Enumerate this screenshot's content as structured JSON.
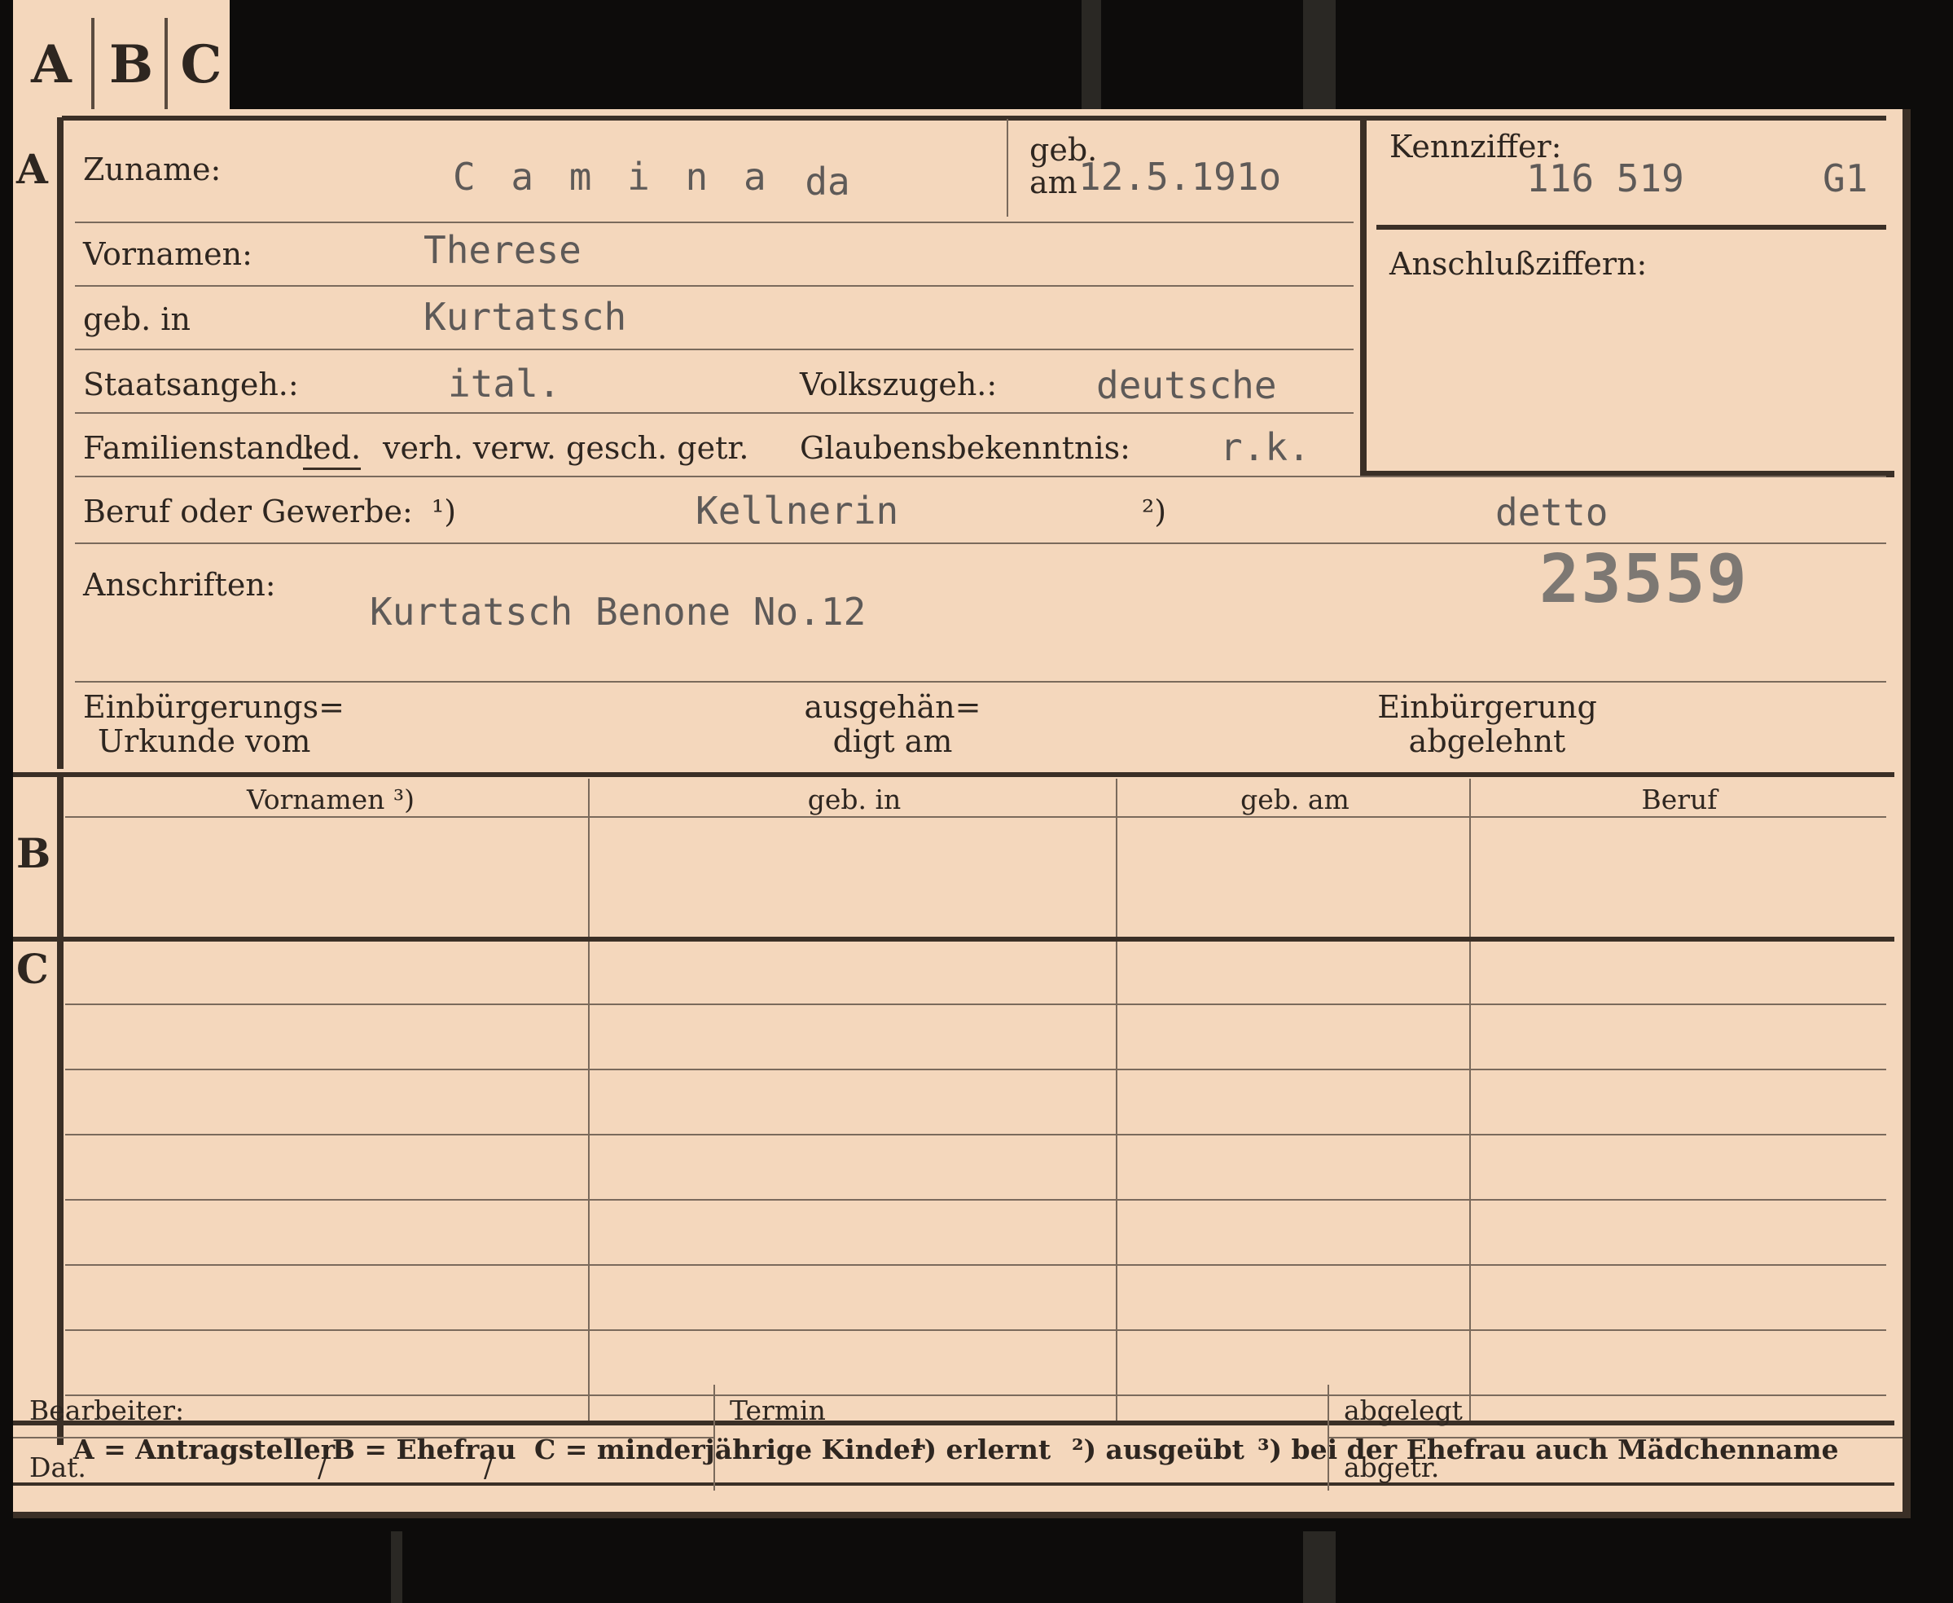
{
  "tab_letters": [
    "A",
    "B",
    "C"
  ],
  "section_letters": {
    "a": "A",
    "b": "B",
    "c": "C"
  },
  "labels": {
    "zuname": "Zuname:",
    "geb_am_top": "geb.",
    "geb_am_bottom": "am",
    "kennziffer": "Kennziffer:",
    "anschlussziffern": "Anschlußziffern:",
    "vornamen": "Vornamen:",
    "geb_in": "geb. in",
    "staatsangeh": "Staatsangeh.:",
    "volkszugeh": "Volkszugeh.:",
    "familienstand": "Familienstand:",
    "fam_led": "led.",
    "fam_rest": "verh. verw. gesch. getr.",
    "glaubensbekenntnis": "Glaubensbekenntnis:",
    "beruf": "Beruf oder Gewerbe:",
    "fn1": "¹)",
    "fn2": "²)",
    "anschriften": "Anschriften:",
    "einbuerg_urkunde_1": "Einbürgerungs=",
    "einbuerg_urkunde_2": "Urkunde vom",
    "ausgehaend_1": "ausgehän=",
    "ausgehaend_2": "digt am",
    "einbuerg_abgelehnt_1": "Einbürgerung",
    "einbuerg_abgelehnt_2": "abgelehnt"
  },
  "values": {
    "zuname_part1": "C a m i n a",
    "zuname_part2": "da",
    "geb_am": "12.5.191o",
    "kennziffer_num": "116 519",
    "kennziffer_code": "G1",
    "vornamen": "Therese",
    "geb_in": "Kurtatsch",
    "staatsangeh": "ital.",
    "volkszugeh": "deutsche",
    "glaubensbekenntnis": "r.k.",
    "beruf_erlernt": "Kellnerin",
    "beruf_ausgeuebt": "detto",
    "anschrift": "Kurtatsch Benone No.12",
    "stamp_number": "23559"
  },
  "table_headers": [
    "Vornamen ³)",
    "geb. in",
    "geb. am",
    "Beruf"
  ],
  "legend": {
    "a": "A = Antragsteller",
    "b": "B = Ehefrau",
    "c": "C = minderjährige Kinder",
    "f1": "¹) erlernt",
    "f2": "²) ausgeübt",
    "f3": "³) bei der Ehefrau auch Mädchenname"
  },
  "footer": {
    "bearbeiter": "Bearbeiter:",
    "dat": "Dat.",
    "slash1": "/",
    "slash2": "/",
    "termin": "Termin",
    "abgelegt": "abgelegt",
    "abgetr": "abgetr."
  }
}
